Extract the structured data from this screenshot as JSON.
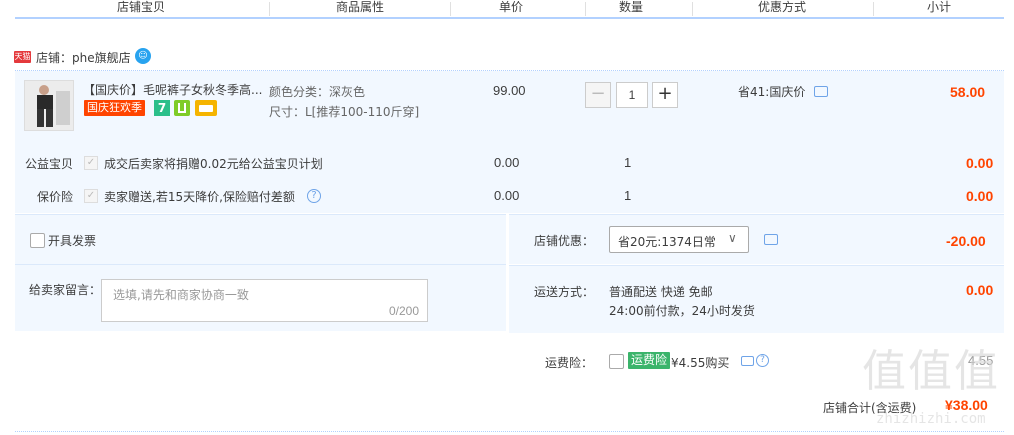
{
  "header": {
    "col_item": "店铺宝贝",
    "col_attr": "商品属性",
    "col_price": "单价",
    "col_qty": "数量",
    "col_discount": "优惠方式",
    "col_subtotal": "小计"
  },
  "shop": {
    "badge": "天猫",
    "label": "店铺：phe旗舰店"
  },
  "product": {
    "title": "【国庆价】毛呢裤子女秋冬季高...",
    "promo_tag": "国庆狂欢季",
    "badge_seven": "7",
    "color_attr": "颜色分类：深灰色",
    "size_attr": "尺寸：L[推荐100-110斤穿]",
    "price": "99.00",
    "quantity": "1",
    "discount": "省41:国庆价",
    "subtotal": "58.00"
  },
  "charity": {
    "label": "公益宝贝",
    "desc": "成交后卖家将捐赠0.02元给公益宝贝计划",
    "price": "0.00",
    "qty": "1",
    "subtotal": "0.00"
  },
  "insurance": {
    "label": "保价险",
    "desc": "卖家赠送,若15天降价,保险赔付差额",
    "price": "0.00",
    "qty": "1",
    "subtotal": "0.00"
  },
  "invoice": {
    "label": "开具发票"
  },
  "shop_discount": {
    "label": "店铺优惠：",
    "selected": "省20元:1374日常",
    "amount": "-20.00"
  },
  "message": {
    "label": "给卖家留言：",
    "placeholder": "选填,请先和商家协商一致",
    "counter": "0/200"
  },
  "shipping": {
    "label": "运送方式：",
    "method": "普通配送 快递 免邮",
    "note": "24:00前付款，24小时发货",
    "amount": "0.00"
  },
  "freight_insurance": {
    "label": "运费险：",
    "tag": "运费险",
    "price": "¥4.55购买",
    "amount": "4.55"
  },
  "total": {
    "label": "店铺合计(含运费)",
    "amount": "¥38.00"
  },
  "watermark": {
    "text": "值值值",
    "url": "zhizhizhi.com"
  },
  "colors": {
    "accent_red": "#ff4400",
    "header_border": "#b2d1ff",
    "section_bg": "#f2f8ff"
  }
}
